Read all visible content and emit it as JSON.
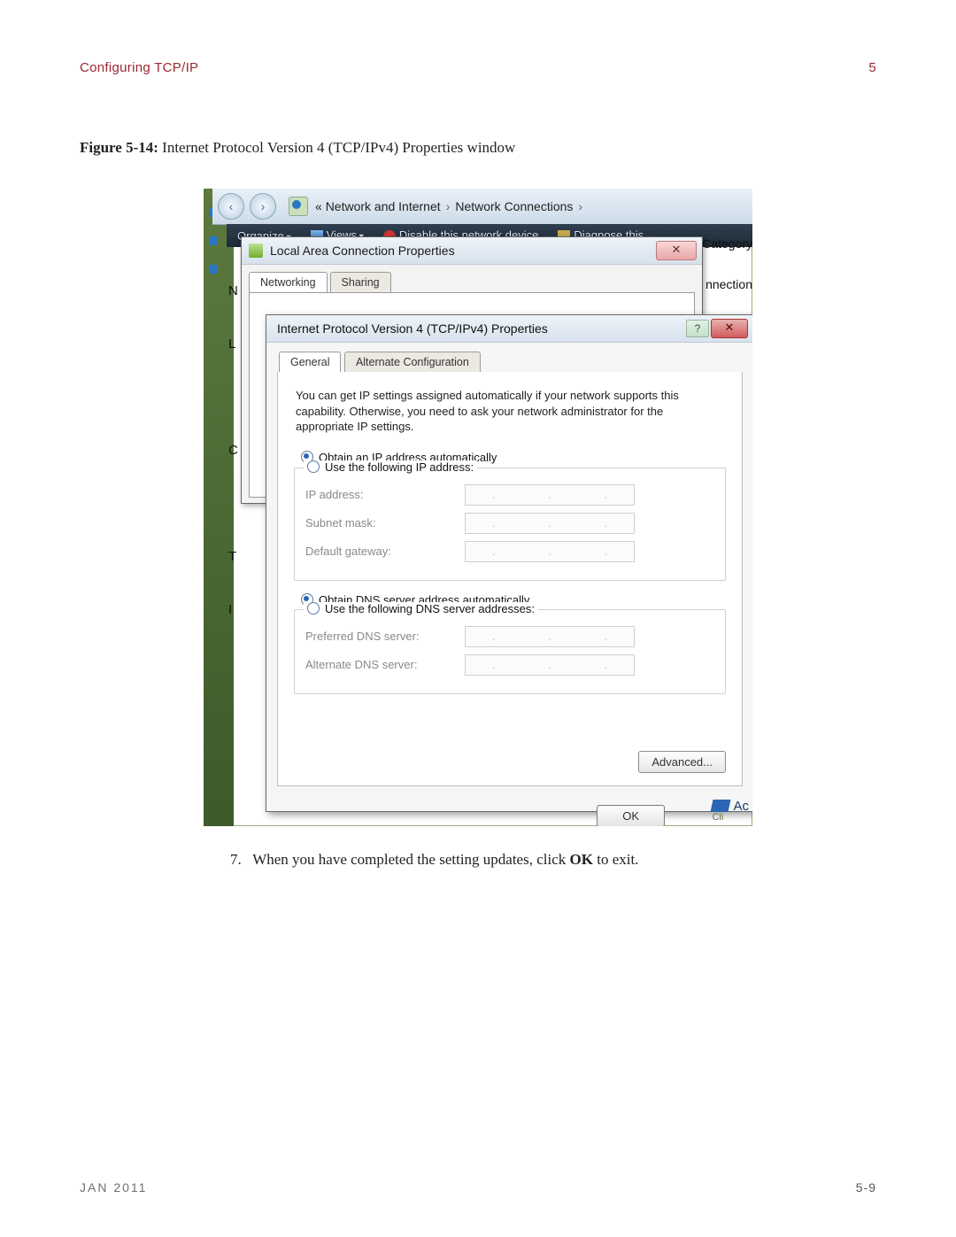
{
  "page": {
    "section_title": "Configuring TCP/IP",
    "section_number": "5",
    "figure_label": "Figure 5-14:",
    "figure_caption": "Internet Protocol Version 4 (TCP/IPv4) Properties window",
    "step_number": "7.",
    "step_text_a": "When you have completed the setting updates, click ",
    "step_bold": "OK",
    "step_text_b": " to exit.",
    "footer_date": "JAN 2011",
    "footer_page": "5-9"
  },
  "explorer": {
    "back_glyph": "«",
    "crumb1": "Network and Internet",
    "crumb2": "Network Connections",
    "sep": "›",
    "toolbar": {
      "organize": "Organize",
      "views": "Views",
      "disable": "Disable this network device",
      "diagnose": "Diagnose this"
    },
    "right_category": "rk Category",
    "right_connection": "nnection",
    "side_letters": "N\nL\nC\nT\nI"
  },
  "lac": {
    "title": "Local Area Connection Properties",
    "close_glyph": "✕",
    "tabs": {
      "networking": "Networking",
      "sharing": "Sharing"
    }
  },
  "ipdlg": {
    "title": "Internet Protocol Version 4 (TCP/IPv4) Properties",
    "help_glyph": "?",
    "close_glyph": "✕",
    "tabs": {
      "general": "General",
      "alt": "Alternate Configuration"
    },
    "description": "You can get IP settings assigned automatically if your network supports this capability. Otherwise, you need to ask your network administrator for the appropriate IP settings.",
    "radio_auto_ip": "Obtain an IP address automatically",
    "radio_static_ip": "Use the following IP address:",
    "fields_ip": {
      "ip": "IP address:",
      "mask": "Subnet mask:",
      "gw": "Default gateway:"
    },
    "radio_auto_dns": "Obtain DNS server address automatically",
    "radio_static_dns": "Use the following DNS server addresses:",
    "fields_dns": {
      "pref": "Preferred DNS server:",
      "alt": "Alternate DNS server:"
    },
    "advanced": "Advanced...",
    "ok": "OK"
  },
  "corner": {
    "text": "Ac",
    "sub": "Cli"
  },
  "dotsep": "."
}
